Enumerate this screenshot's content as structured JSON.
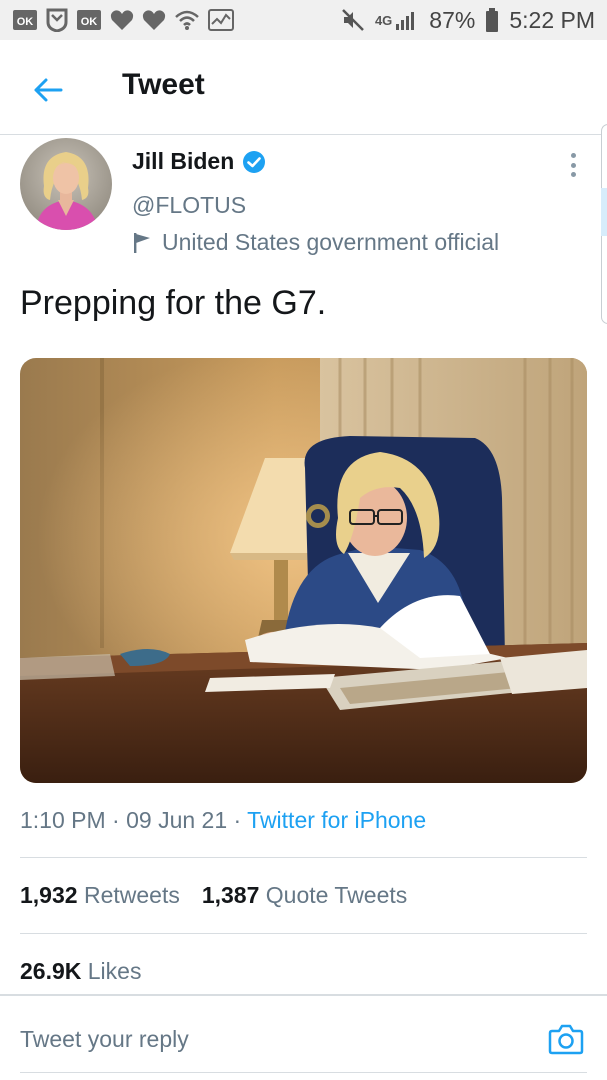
{
  "status_bar": {
    "signal_label": "4G",
    "battery": "87%",
    "time": "5:22 PM"
  },
  "header": {
    "title": "Tweet"
  },
  "tweet": {
    "author_name": "Jill Biden",
    "author_handle": "@FLOTUS",
    "author_label": "United States government official",
    "text": "Prepping for the G7.",
    "time": "1:10 PM",
    "date": "09 Jun 21",
    "source": "Twitter for iPhone",
    "retweets_count": "1,932",
    "retweets_label": "Retweets",
    "quotes_count": "1,387",
    "quotes_label": "Quote Tweets",
    "likes_count": "26.9K",
    "likes_label": "Likes"
  },
  "reply": {
    "placeholder": "Tweet your reply"
  },
  "colors": {
    "accent": "#1da1f2",
    "text_primary": "#14171a",
    "text_secondary": "#657786",
    "divider": "#d8dde1"
  }
}
